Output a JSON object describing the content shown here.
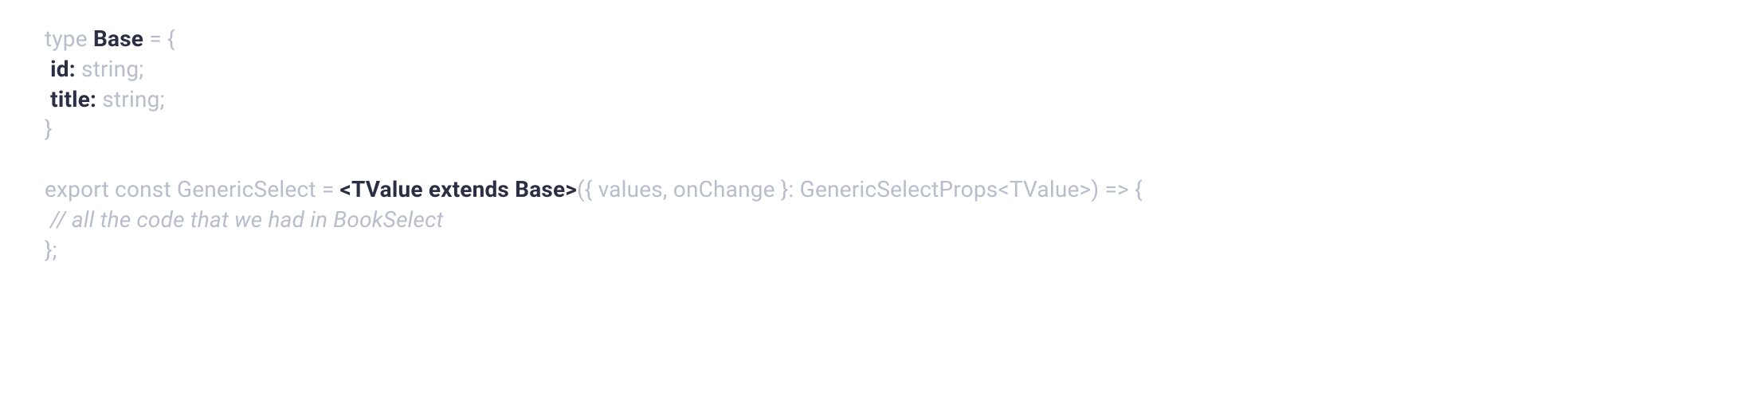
{
  "code": {
    "l1": {
      "a": "type ",
      "b": "Base",
      "c": " = {"
    },
    "l2": {
      "a": "id:",
      "b": " string;"
    },
    "l3": {
      "a": "title:",
      "b": " string;"
    },
    "l4": "}",
    "l5": {
      "a": "export const GenericSelect = ",
      "b": "<TValue ",
      "c": "extends Base",
      "d": ">",
      "e": "({ values, onChange }: GenericSelectProps<TValue>) => {"
    },
    "l6": " // all the code that we had in BookSelect",
    "l7": "};"
  }
}
